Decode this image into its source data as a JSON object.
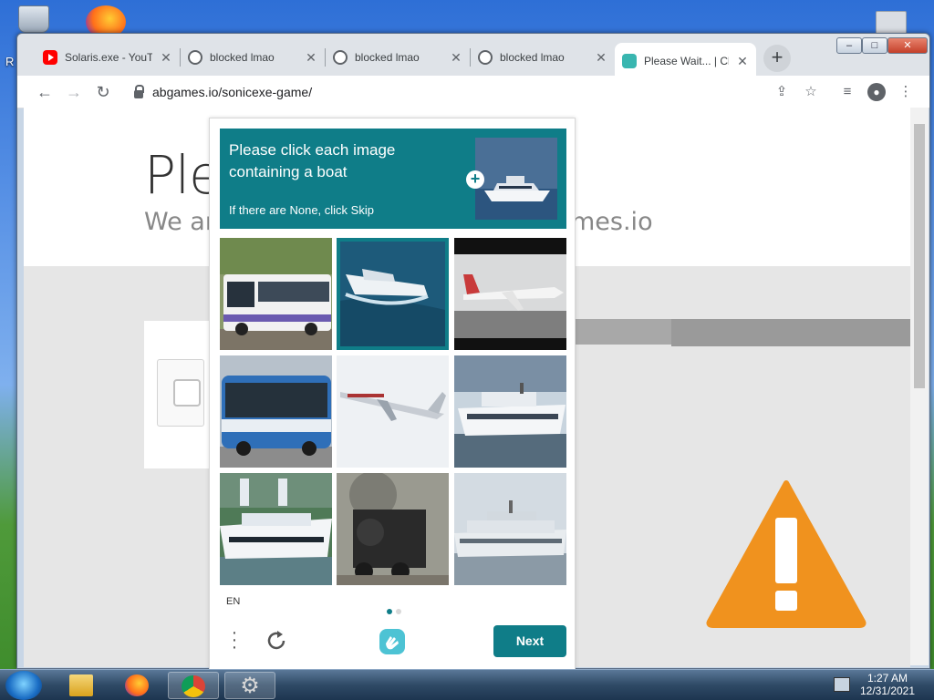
{
  "browser": {
    "tabs": [
      {
        "label": "Solaris.exe - YouTube",
        "favicon": "youtube-icon",
        "active": false
      },
      {
        "label": "blocked lmao",
        "favicon": "globe-icon",
        "active": false
      },
      {
        "label": "blocked lmao",
        "favicon": "globe-icon",
        "active": false
      },
      {
        "label": "blocked lmao",
        "favicon": "globe-icon",
        "active": false
      },
      {
        "label": "Please Wait... | Cloudflare",
        "favicon": "captcha-icon",
        "active": true
      }
    ],
    "url": "abgames.io/sonicexe-game/",
    "new_tab": "+",
    "window_controls": {
      "minimize": "–",
      "maximize": "□",
      "close": "✕"
    }
  },
  "page": {
    "heading": "Ple",
    "subheading_left": "We ar",
    "subheading_right": "mes.io"
  },
  "captcha": {
    "prompt": "Please click each image containing a boat",
    "hint": "If there are None, click Skip",
    "plus": "+",
    "tiles": [
      {
        "label": "bus",
        "selected": false
      },
      {
        "label": "boat",
        "selected": true
      },
      {
        "label": "airplane",
        "selected": false
      },
      {
        "label": "bus",
        "selected": false
      },
      {
        "label": "airplane",
        "selected": false
      },
      {
        "label": "boat",
        "selected": false
      },
      {
        "label": "boat",
        "selected": false
      },
      {
        "label": "train",
        "selected": false
      },
      {
        "label": "boat",
        "selected": false
      }
    ],
    "language": "EN",
    "next_label": "Next",
    "page_dots": 2,
    "active_dot": 0,
    "accent": "#0f7d88"
  },
  "taskbar": {
    "time": "1:27 AM",
    "date": "12/31/2021"
  },
  "colors": {
    "warning": "#f0921e",
    "captcha_accent": "#0f7d88"
  }
}
